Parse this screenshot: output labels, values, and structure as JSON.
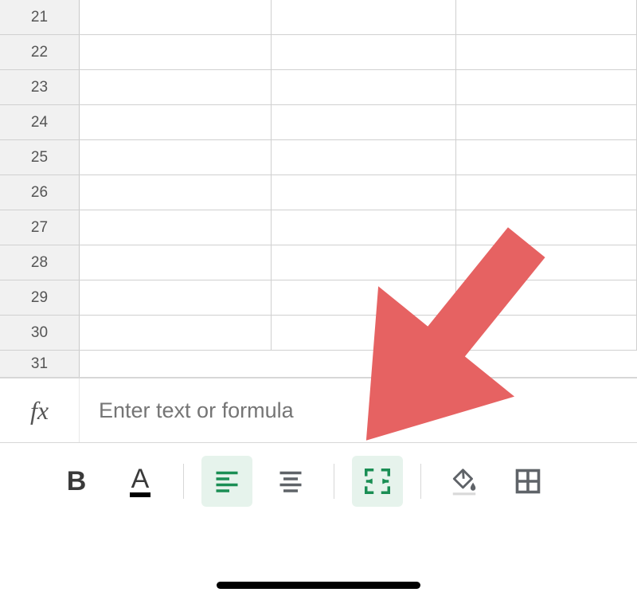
{
  "grid": {
    "rows": [
      "21",
      "22",
      "23",
      "24",
      "25",
      "26",
      "27",
      "28",
      "29",
      "30",
      "31"
    ]
  },
  "formula_bar": {
    "fx": "fx",
    "placeholder": "Enter text or formula"
  },
  "toolbar": {
    "bold": "B",
    "text_color": "A"
  },
  "colors": {
    "active_green": "#1a8e54",
    "icon_gray": "#5f6368",
    "arrow": "#e66262"
  }
}
